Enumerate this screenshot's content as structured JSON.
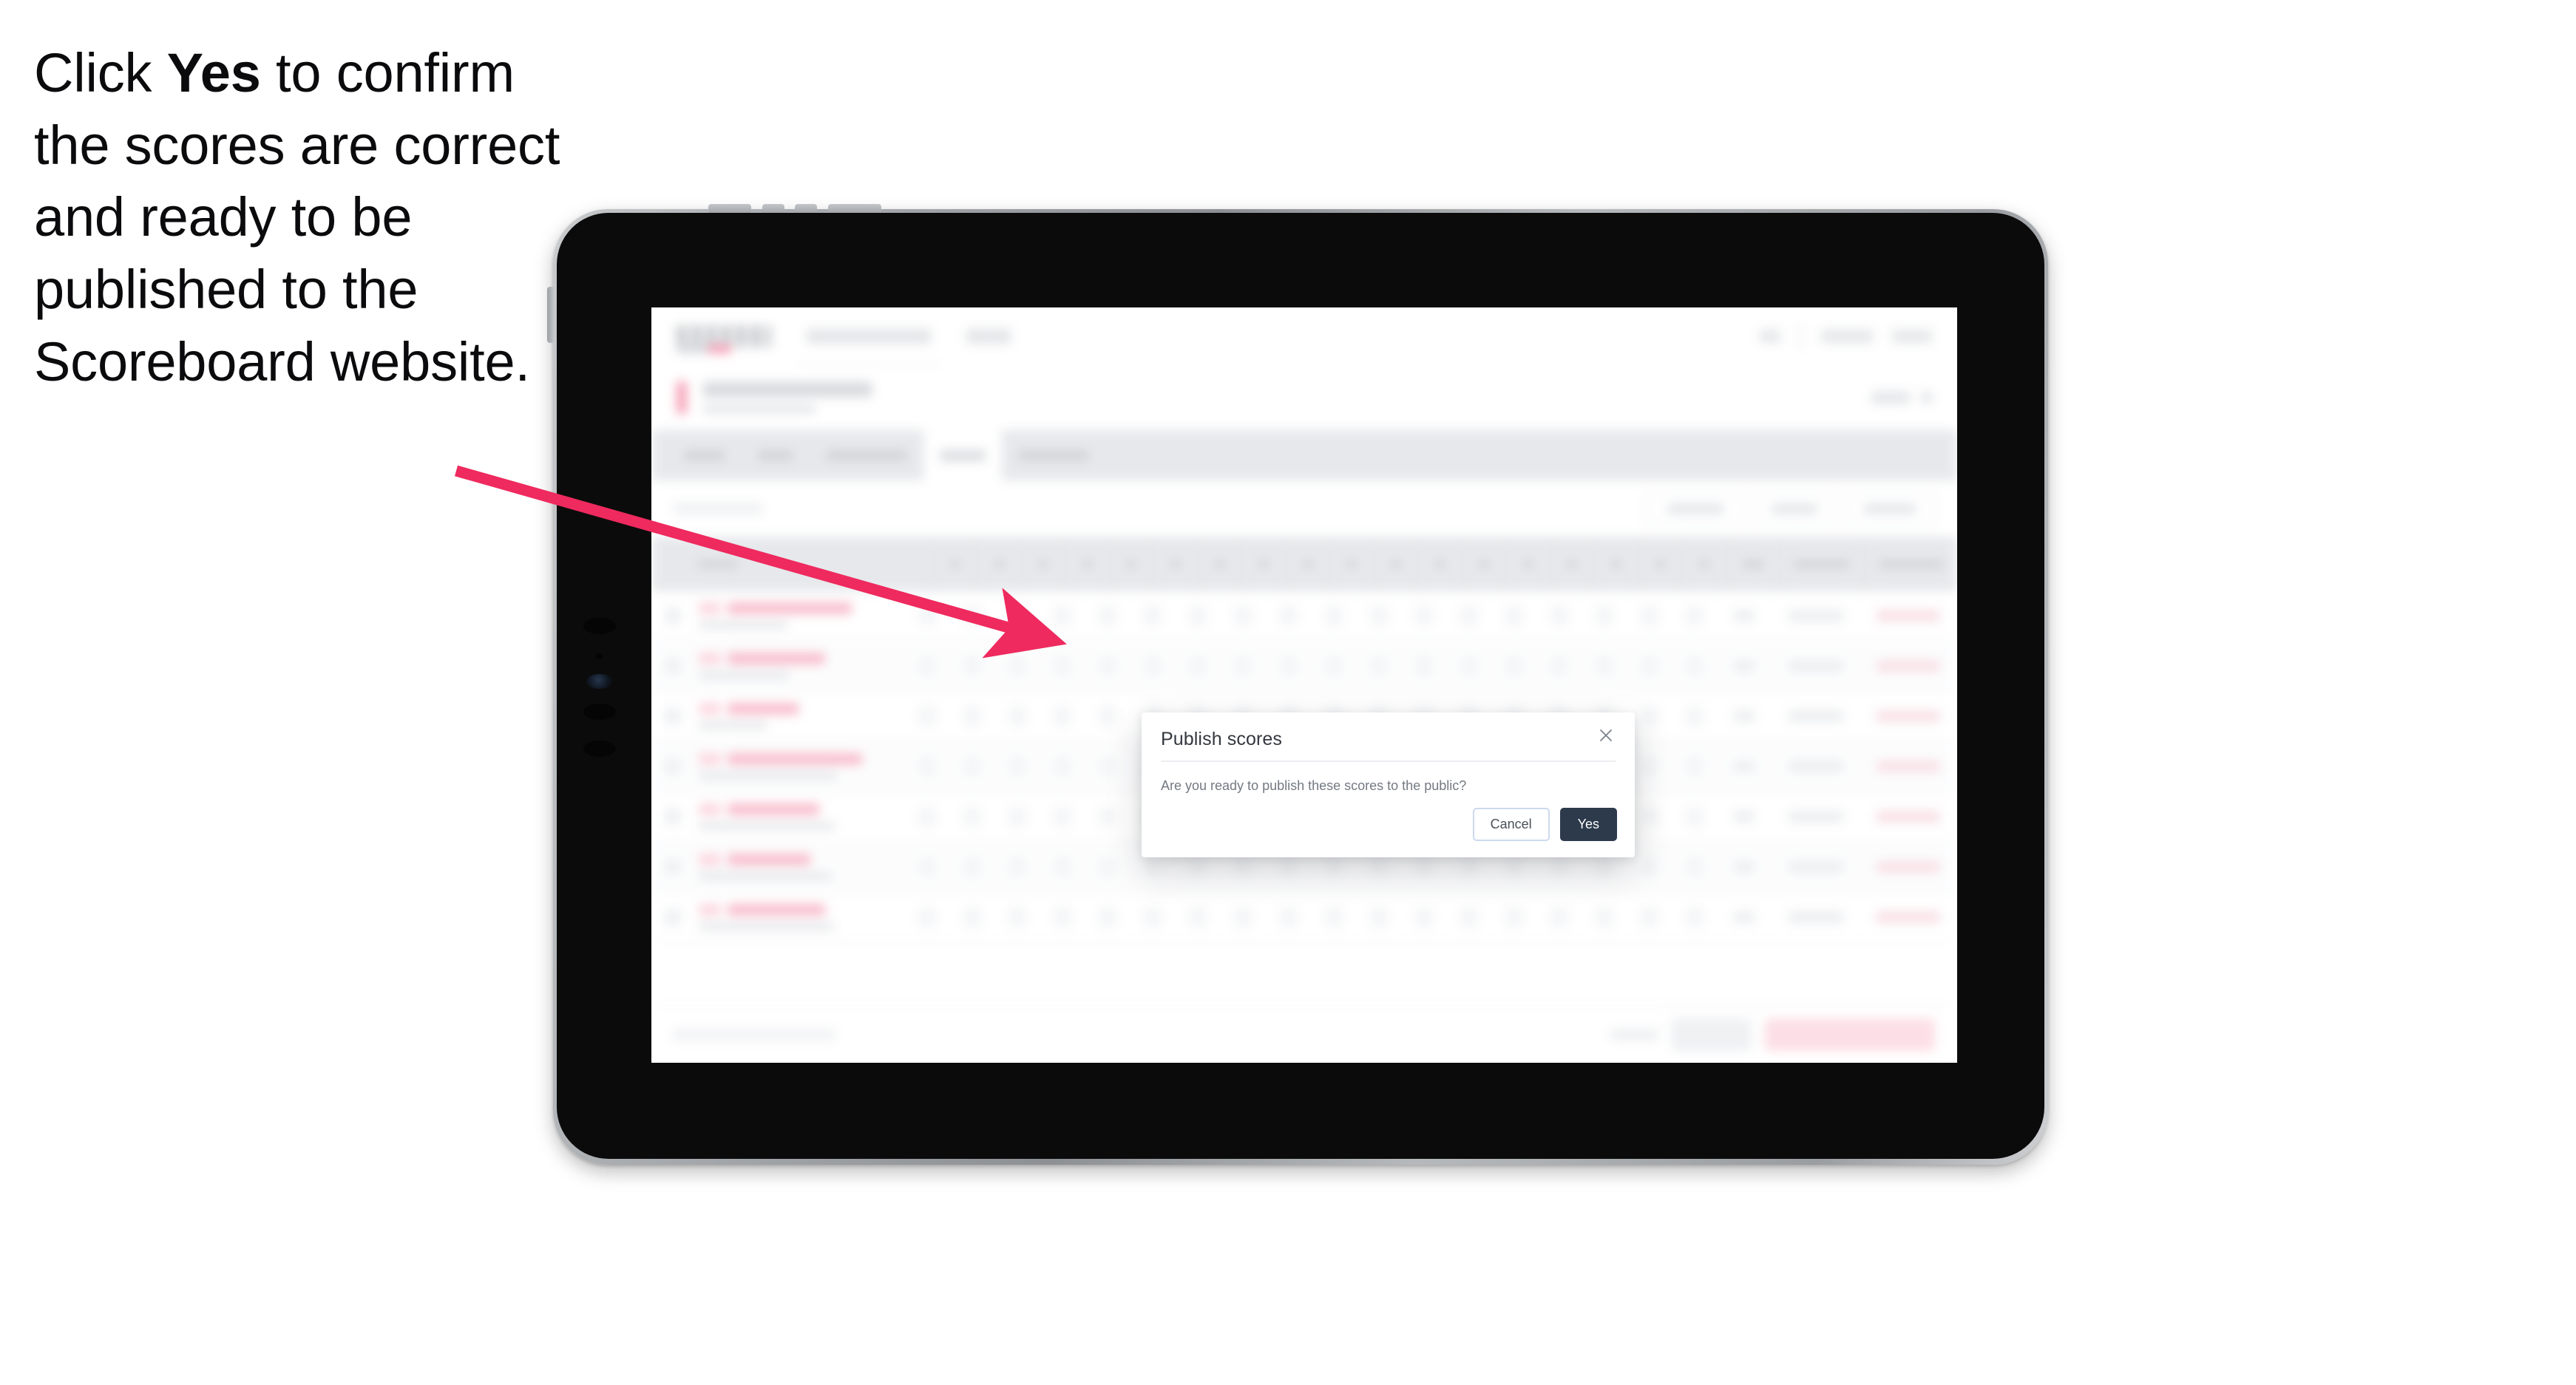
{
  "instruction": {
    "before": "Click ",
    "emphasis": "Yes",
    "after": " to confirm the scores are correct and ready to be published to the Scoreboard website."
  },
  "colors": {
    "accent_pink": "#ee2a5e",
    "primary_dark": "#2c3a4c",
    "cancel_border": "#ccd9ee",
    "modal_bg": "#ffffff",
    "page_bg": "#ffffff",
    "device_bezel": "#0b0b0b",
    "device_rim": "#a9acb0",
    "tab_bar": "#d4d7dc",
    "player_name": "#f48aa6",
    "danger_button": "#fbc6d2"
  },
  "device": {
    "type": "tablet",
    "orientation": "landscape"
  },
  "modal": {
    "title": "Publish scores",
    "close_icon": "close-icon",
    "body": "Are you ready to publish these scores to the public?",
    "buttons": {
      "cancel": "Cancel",
      "confirm": "Yes"
    }
  },
  "background_app": {
    "note": "blurred / obscured behind the modal",
    "tabs_count": 5,
    "active_tab_index": 3,
    "filters_count": 3,
    "table": {
      "score_columns": 18,
      "wide_columns": 3,
      "rows": 7
    }
  },
  "annotation": {
    "arrow_icon": "arrow-pointer-icon",
    "points_to": "modal-dialog"
  }
}
